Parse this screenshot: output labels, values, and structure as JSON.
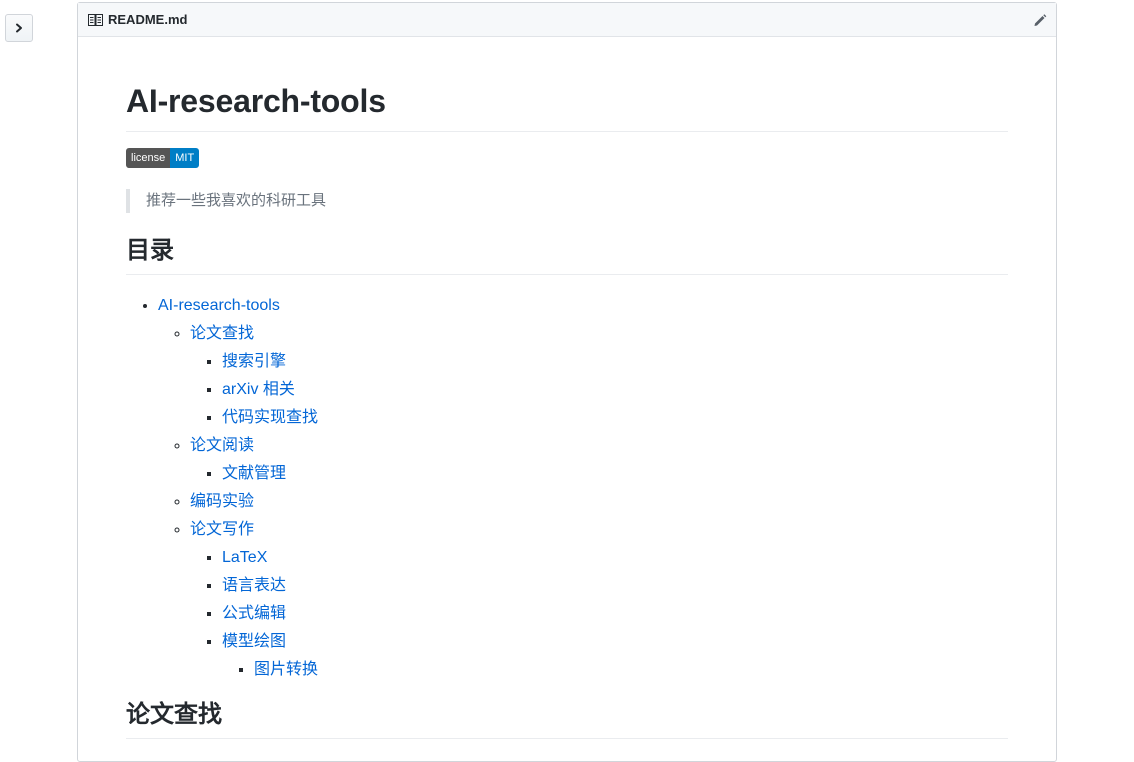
{
  "file": {
    "name": "README.md",
    "icon": "book-icon",
    "edit_icon": "pencil-icon",
    "toggle_icon": "chevron-right-icon"
  },
  "readme": {
    "title": "AI-research-tools",
    "badge": {
      "left": "license",
      "right": "MIT",
      "left_color": "#555555",
      "right_color": "#007ec6"
    },
    "quote": "推荐一些我喜欢的科研工具",
    "toc_heading": "目录",
    "toc": {
      "root": "AI-research-tools",
      "items": [
        {
          "label": "论文查找",
          "children": [
            "搜索引擎",
            "arXiv 相关",
            "代码实现查找"
          ]
        },
        {
          "label": "论文阅读",
          "children": [
            "文献管理"
          ]
        },
        {
          "label": "编码实验",
          "children": []
        },
        {
          "label": "论文写作",
          "children": [
            "LaTeX",
            "语言表达",
            "公式编辑",
            "模型绘图"
          ],
          "grandchild": "图片转换"
        }
      ]
    },
    "section_heading": "论文查找"
  },
  "colors": {
    "link": "#0366d6",
    "text": "#24292e",
    "muted": "#6a737d"
  }
}
